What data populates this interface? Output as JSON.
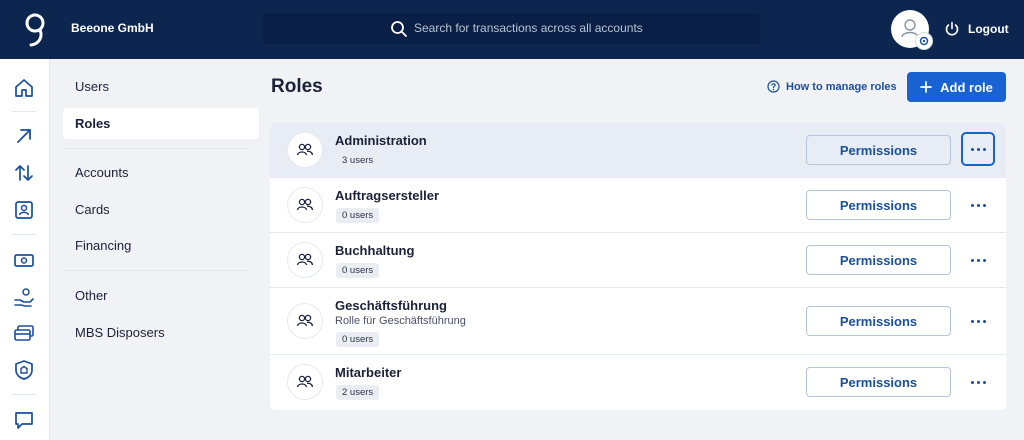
{
  "header": {
    "company": "Beeone GmbH",
    "search_placeholder": "Search for transactions across all accounts",
    "logout_label": "Logout"
  },
  "rail": {
    "icons": [
      "home-icon",
      "arrow-up-right-icon",
      "transfer-arrows-icon",
      "contact-card-icon",
      "cash-icon",
      "hand-coin-icon",
      "cards-icon",
      "shield-icon",
      "chat-icon"
    ]
  },
  "subnav": {
    "items": [
      {
        "label": "Users",
        "active": false
      },
      {
        "label": "Roles",
        "active": true
      },
      {
        "label": "Accounts",
        "active": false
      },
      {
        "label": "Cards",
        "active": false
      },
      {
        "label": "Financing",
        "active": false
      },
      {
        "label": "Other",
        "active": false
      },
      {
        "label": "MBS Disposers",
        "active": false
      }
    ]
  },
  "main": {
    "title": "Roles",
    "help_link": "How to manage roles",
    "add_button": "Add role",
    "permissions_label": "Permissions",
    "roles": [
      {
        "name": "Administration",
        "description": "",
        "users": "3 users"
      },
      {
        "name": "Auftragsersteller",
        "description": "",
        "users": "0 users"
      },
      {
        "name": "Buchhaltung",
        "description": "",
        "users": "0 users"
      },
      {
        "name": "Geschäftsführung",
        "description": "Rolle für Geschäftsführung",
        "users": "0 users"
      },
      {
        "name": "Mitarbeiter",
        "description": "",
        "users": "2 users"
      }
    ]
  },
  "colors": {
    "header_bg": "#0d2650",
    "primary": "#1862d1",
    "link": "#1a4f9c",
    "selected_row": "#e8ecf5"
  }
}
